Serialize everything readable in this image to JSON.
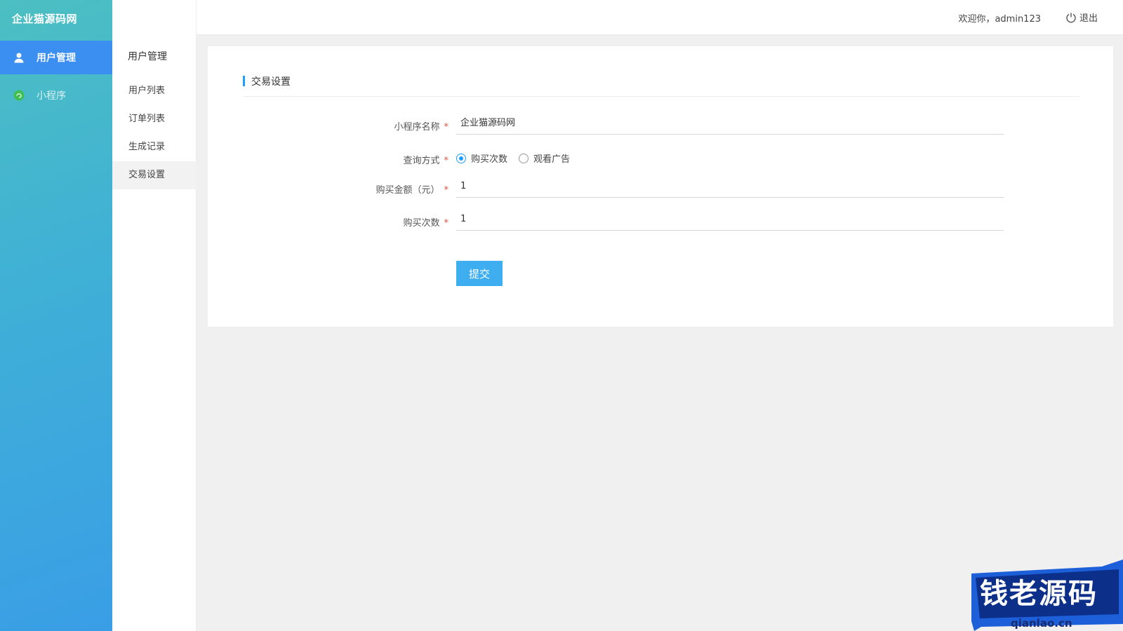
{
  "brand": "企业猫源码网",
  "sidebar": {
    "items": [
      {
        "label": "用户管理",
        "icon": "user-icon",
        "active": true
      },
      {
        "label": "小程序",
        "icon": "miniprogram-icon",
        "active": false
      }
    ]
  },
  "topbar": {
    "menu_icon": "menu-fold-icon",
    "refresh_icon": "refresh-icon",
    "welcome": "欢迎你，admin123",
    "logout": "退出"
  },
  "subnav": {
    "title": "用户管理",
    "items": [
      {
        "label": "用户列表"
      },
      {
        "label": "订单列表"
      },
      {
        "label": "生成记录"
      },
      {
        "label": "交易设置",
        "active": true
      }
    ]
  },
  "form": {
    "title": "交易设置",
    "name_label": "小程序名称",
    "name_value": "企业猫源码网",
    "query_label": "查询方式",
    "query_options": [
      "购买次数",
      "观看广告"
    ],
    "query_selected": "购买次数",
    "amount_label": "购买金额（元）",
    "amount_value": "1",
    "count_label": "购买次数",
    "count_value": "1",
    "required_mark": "*",
    "submit": "提交"
  },
  "watermark": {
    "text": "钱老源码",
    "url": "qianlao.cn"
  },
  "colors": {
    "accent": "#1e9fff",
    "sidebar_active": "#3b8ff0",
    "submit": "#3eaef0",
    "required": "#e0533f"
  }
}
